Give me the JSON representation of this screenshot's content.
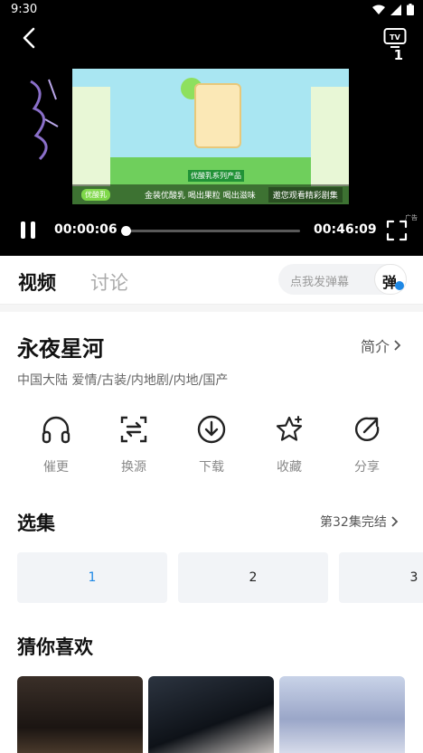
{
  "status_bar": {
    "time": "9:30"
  },
  "player": {
    "tv_badge": "1",
    "current_time": "00:00:06",
    "duration": "00:46:09",
    "progress": 0.002,
    "ad_tag": "广告",
    "ad_brand": "优酸乳",
    "ad_slogan": "金装优酸乳 喝出果粒 喝出滋味",
    "ad_notice": "邀您观看精彩剧集",
    "ad_sub": "优酸乳系列产品"
  },
  "tabs": [
    {
      "label": "视频",
      "active": true
    },
    {
      "label": "讨论",
      "active": false
    }
  ],
  "danmaku": {
    "placeholder": "点我发弹幕",
    "toggle_label": "弹"
  },
  "show": {
    "title": "永夜星河",
    "intro_label": "简介",
    "meta": "中国大陆  爱情/古装/内地剧/内地/国产"
  },
  "actions": [
    {
      "label": "催更",
      "icon": "headphones-icon"
    },
    {
      "label": "换源",
      "icon": "switch-source-icon"
    },
    {
      "label": "下载",
      "icon": "download-icon"
    },
    {
      "label": "收藏",
      "icon": "star-icon"
    },
    {
      "label": "分享",
      "icon": "share-icon"
    }
  ],
  "episodes": {
    "title": "选集",
    "status": "第32集完结",
    "items": [
      "1",
      "2",
      "3"
    ],
    "active_index": 0
  },
  "recommend": {
    "title": "猜你喜欢"
  },
  "colors": {
    "accent": "#1e88e5",
    "chip_bg": "#f2f4f7"
  }
}
